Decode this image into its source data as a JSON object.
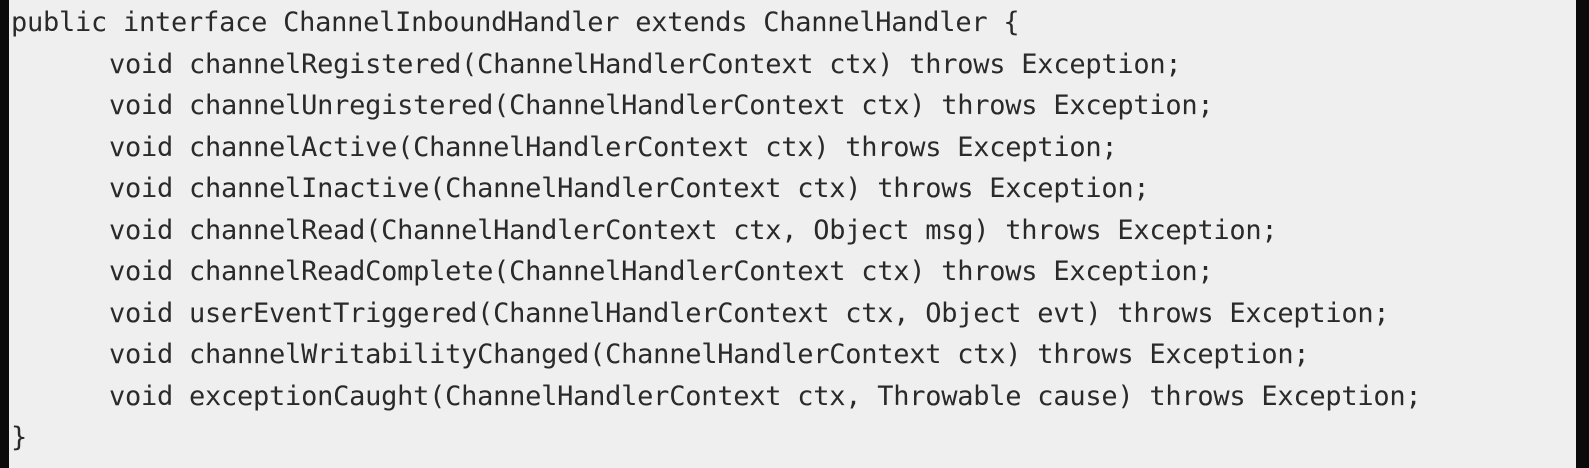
{
  "code": {
    "header": "public interface ChannelInboundHandler extends ChannelHandler {",
    "methods": [
      "void channelRegistered(ChannelHandlerContext ctx) throws Exception;",
      "void channelUnregistered(ChannelHandlerContext ctx) throws Exception;",
      "void channelActive(ChannelHandlerContext ctx) throws Exception;",
      "void channelInactive(ChannelHandlerContext ctx) throws Exception;",
      "void channelRead(ChannelHandlerContext ctx, Object msg) throws Exception;",
      "void channelReadComplete(ChannelHandlerContext ctx) throws Exception;",
      "void userEventTriggered(ChannelHandlerContext ctx, Object evt) throws Exception;",
      "void channelWritabilityChanged(ChannelHandlerContext ctx) throws Exception;",
      "void exceptionCaught(ChannelHandlerContext ctx, Throwable cause) throws Exception;"
    ],
    "footer": "}"
  },
  "colors": {
    "panel_background": "#efefef",
    "border": "#0b0b0b",
    "text": "#2a2a2a"
  }
}
